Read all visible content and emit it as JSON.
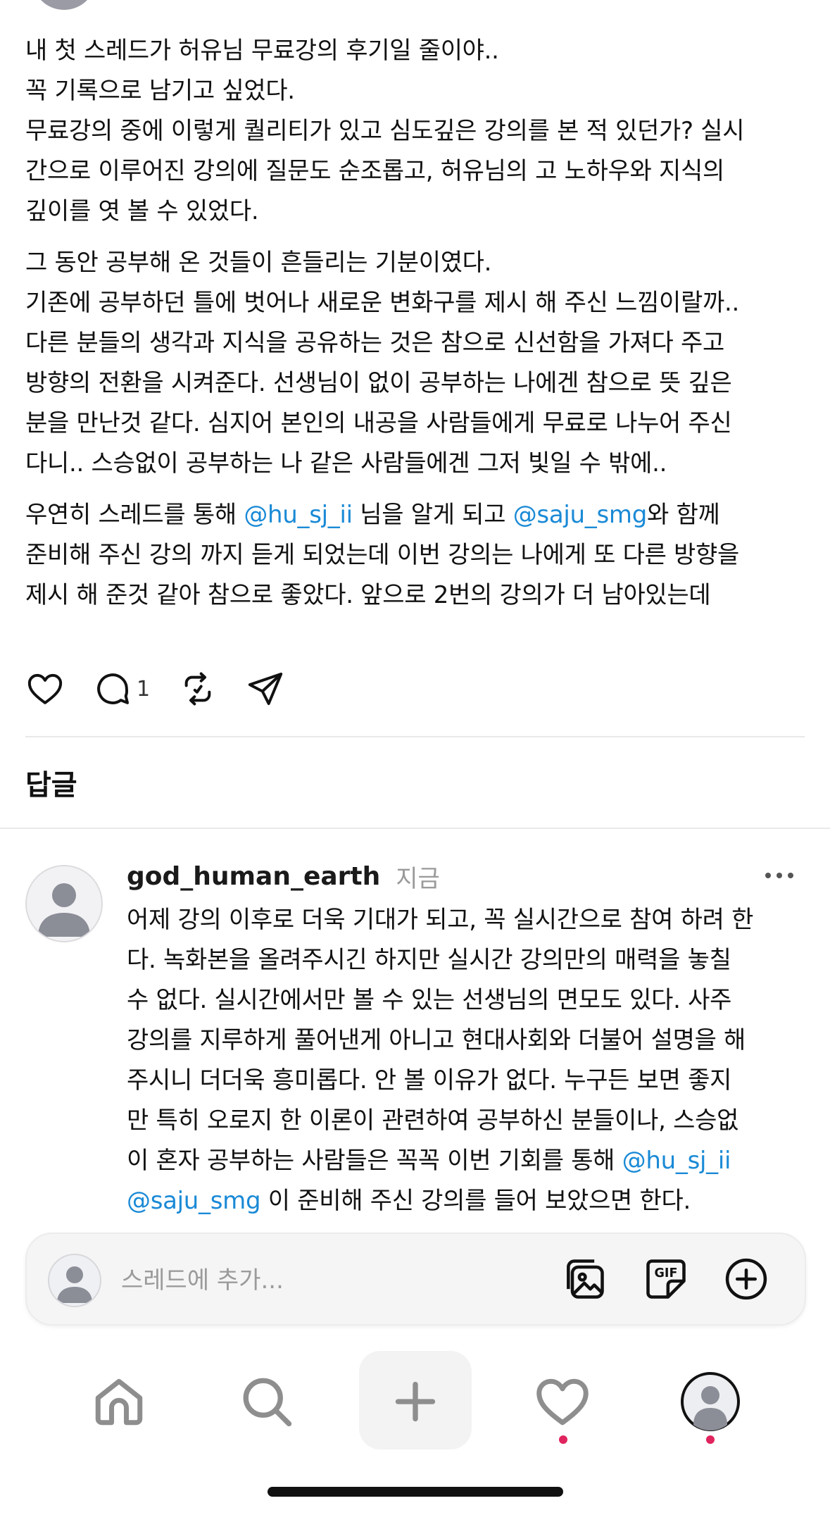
{
  "post": {
    "p1": "내 첫 스레드가 허유님 무료강의 후기일 줄이야..",
    "p2": "꼭 기록으로 남기고 싶었다.",
    "p3_l1": "무료강의 중에 이렇게 퀄리티가 있고 심도깊은 강의를 본 적 있던가? 실시",
    "p3_l2": "간으로 이루어진 강의에 질문도 순조롭고, 허유님의 고 노하우와 지식의",
    "p3_l3": "깊이를 엿 볼 수 있었다.",
    "p4": "그 동안 공부해 온 것들이 흔들리는 기분이였다.",
    "p5_l1": "기존에 공부하던 틀에 벗어나 새로운 변화구를 제시 해 주신 느낌이랄까..",
    "p5_l2": "다른 분들의 생각과 지식을 공유하는 것은 참으로 신선함을 가져다 주고",
    "p5_l3": "방향의 전환을 시켜준다. 선생님이 없이 공부하는 나에겐 참으로 뜻 깊은",
    "p5_l4": "분을 만난것 같다. 심지어 본인의 내공을 사람들에게 무료로 나누어 주신",
    "p5_l5": "다니.. 스승없이 공부하는 나 같은 사람들에겐 그저 빛일 수 밖에..",
    "p6_l1_a": "우연히 스레드를 통해 ",
    "p6_mention1": "@hu_sj_ii",
    "p6_l1_b": " 님을 알게 되고  ",
    "p6_mention2": "@saju_smg",
    "p6_l1_c": "와 함께",
    "p6_l2": "준비해 주신 강의 까지 듣게 되었는데 이번 강의는 나에게 또 다른 방향을",
    "p6_l3": "제시 해 준것 같아 참으로 좋았다. 앞으로 2번의 강의가 더 남아있는데"
  },
  "actions": {
    "like_icon": "heart-icon",
    "comment_icon": "comment-icon",
    "comment_count": "1",
    "repost_icon": "repost-icon",
    "share_icon": "send-icon"
  },
  "replies_title": "답글",
  "reply": {
    "username": "god_human_earth",
    "time": "지금",
    "l1": "어제 강의 이후로 더욱 기대가 되고, 꼭 실시간으로 참여 하려 한",
    "l2": "다. 녹화본을 올려주시긴 하지만 실시간 강의만의 매력을 놓칠",
    "l3": "수 없다. 실시간에서만 볼 수 있는 선생님의 면모도 있다. 사주",
    "l4": "강의를 지루하게 풀어낸게 아니고 현대사회와 더불어 설명을 해",
    "l5": "주시니 더더욱 흥미롭다.  안 볼 이유가 없다. 누구든 보면 좋지",
    "l6": "만 특히 오로지 한 이론이 관련하여 공부하신 분들이나, 스승없",
    "l7_a": "이 혼자 공부하는 사람들은 꼭꼭 이번 기회를 통해 ",
    "l7_mention": "@hu_sj_ii",
    "l8_mention": "@saju_smg",
    "l8_b": " 이 준비해 주신 강의를 들어 보았으면 한다."
  },
  "composer": {
    "placeholder": "스레드에 추가...",
    "icons": [
      "gallery-icon",
      "gif-icon",
      "add-circle-icon"
    ]
  },
  "tabbar": {
    "items": [
      "home-icon",
      "search-icon",
      "create-icon",
      "activity-icon",
      "profile-icon"
    ]
  },
  "colors": {
    "mention": "#1a8ad6",
    "text": "#111111",
    "secondary": "#9a9a9a",
    "notification_dot": "#e0245e"
  }
}
